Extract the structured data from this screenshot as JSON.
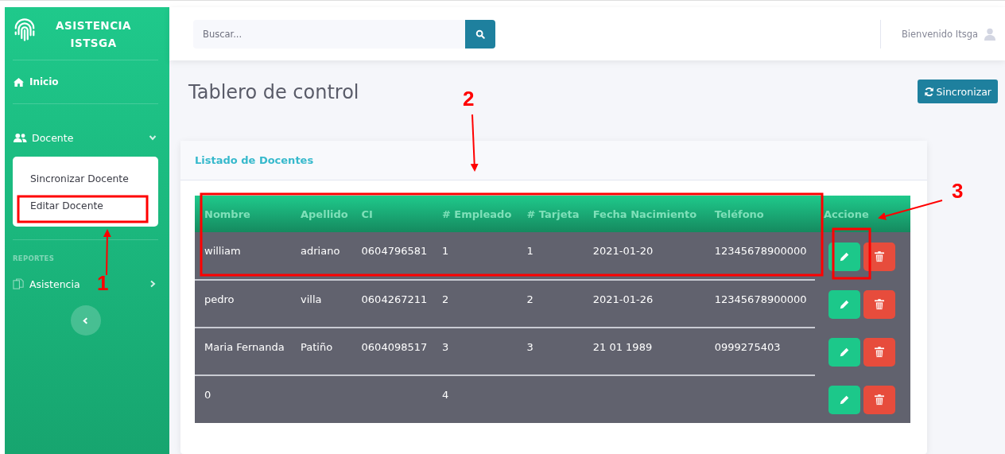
{
  "sidebar": {
    "brand": [
      "ASISTENCIA",
      "ISTSGA"
    ],
    "items": [
      {
        "kind": "link",
        "label": "Inicio"
      },
      {
        "kind": "group",
        "label": "Docente",
        "expanded": true,
        "children": [
          {
            "label": "Sincronizar Docente"
          },
          {
            "label": "Editar Docente"
          }
        ]
      },
      {
        "kind": "heading",
        "label": "REPORTES"
      },
      {
        "kind": "group",
        "label": "Asistencia",
        "expanded": false
      }
    ]
  },
  "search": {
    "placeholder": "Buscar..."
  },
  "user": {
    "greeting": "Bienvenido Itsga"
  },
  "page": {
    "title": "Tablero de control",
    "sync_button": "Sincronizar"
  },
  "card": {
    "title": "Listado de Docentes"
  },
  "table": {
    "columns": [
      "Nombre",
      "Apellido",
      "CI",
      "# Empleado",
      "# Tarjeta",
      "Fecha Nacimiento",
      "Teléfono",
      "Accione"
    ],
    "rows": [
      {
        "cells": [
          "william",
          "adriano",
          "0604796581",
          "1",
          "1",
          "2021-01-20",
          "12345678900000"
        ]
      },
      {
        "cells": [
          "pedro",
          "villa",
          "0604267211",
          "2",
          "2",
          "2021-01-26",
          "12345678900000"
        ]
      },
      {
        "cells": [
          "Maria Fernanda",
          "Patiño",
          "0604098517",
          "3",
          "3",
          "21 01 1989",
          "0999275403"
        ]
      },
      {
        "cells": [
          "0",
          "",
          "",
          "4",
          "",
          "",
          ""
        ]
      }
    ]
  },
  "annotations": [
    {
      "label": "1"
    },
    {
      "label": "2"
    },
    {
      "label": "3"
    }
  ]
}
